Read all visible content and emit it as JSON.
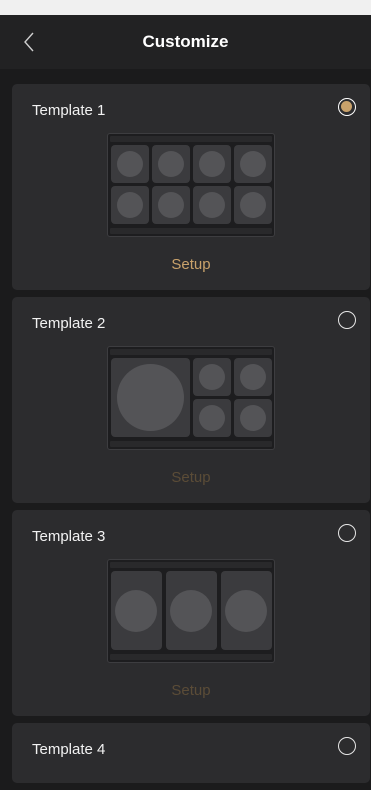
{
  "header": {
    "title": "Customize"
  },
  "colors": {
    "accent": "#c9a26b",
    "background": "#1b1b1c",
    "card": "#2c2c2e"
  },
  "templates": [
    {
      "label": "Template 1",
      "selected": true,
      "setup_label": "Setup",
      "layout": "2x4-grid"
    },
    {
      "label": "Template 2",
      "selected": false,
      "setup_label": "Setup",
      "layout": "large-plus-2x2"
    },
    {
      "label": "Template 3",
      "selected": false,
      "setup_label": "Setup",
      "layout": "3-columns"
    },
    {
      "label": "Template 4",
      "selected": false
    }
  ]
}
